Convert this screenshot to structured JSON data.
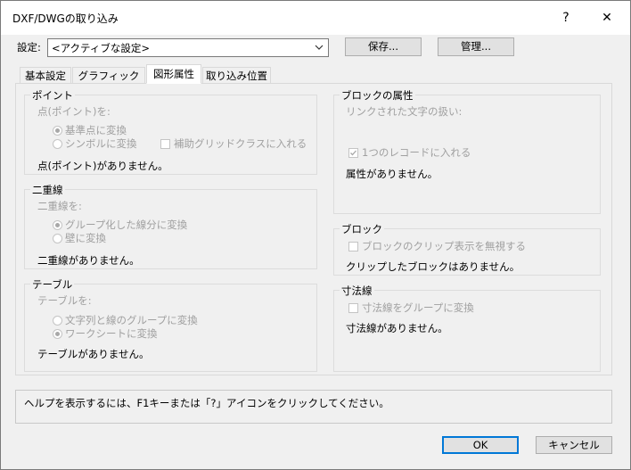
{
  "window": {
    "title": "DXF/DWGの取り込み",
    "help_btn": "?",
    "close_btn": "✕"
  },
  "settings": {
    "label": "設定:",
    "value": "<アクティブな設定>",
    "save_label": "保存...",
    "manage_label": "管理..."
  },
  "tabs": [
    "基本設定",
    "グラフィック属性",
    "図形属性",
    "取り込み位置"
  ],
  "point": {
    "title": "ポイント",
    "prompt": "点(ポイント)を:",
    "opt1": "基準点に変換",
    "opt2": "シンボルに変換",
    "aux": "補助グリッドクラスに入れる",
    "status": "点(ポイント)がありません。"
  },
  "double_line": {
    "title": "二重線",
    "prompt": "二重線を:",
    "opt1": "グループ化した線分に変換",
    "opt2": "壁に変換",
    "status": "二重線がありません。"
  },
  "table": {
    "title": "テーブル",
    "prompt": "テーブルを:",
    "opt1": "文字列と線のグループに変換",
    "opt2": "ワークシートに変換",
    "status": "テーブルがありません。"
  },
  "block_attr": {
    "title": "ブロックの属性",
    "prompt": "リンクされた文字の扱い:",
    "check": "1つのレコードに入れる",
    "status": "属性がありません。"
  },
  "block": {
    "title": "ブロック",
    "check": "ブロックのクリップ表示を無視する",
    "status": "クリップしたブロックはありません。"
  },
  "dimension": {
    "title": "寸法線",
    "check": "寸法線をグループに変換",
    "status": "寸法線がありません。"
  },
  "help_text": "ヘルプを表示するには、F1キーまたは「?」アイコンをクリックしてください。",
  "footer": {
    "ok_label": "OK",
    "cancel_label": "キャンセル"
  }
}
